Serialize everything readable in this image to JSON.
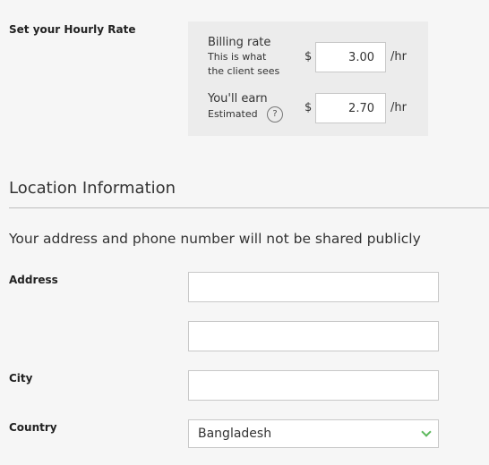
{
  "rate_section": {
    "title": "Set your Hourly Rate",
    "billing": {
      "label": "Billing rate",
      "sub1": "This is what",
      "sub2": "the client sees",
      "currency": "$",
      "value": "3.00",
      "unit": "/hr"
    },
    "earn": {
      "label": "You'll earn",
      "sub": "Estimated",
      "help": "?",
      "currency": "$",
      "value": "2.70",
      "unit": "/hr"
    }
  },
  "location": {
    "title": "Location Information",
    "notice": "Your address and phone number will not be shared publicly",
    "address_label": "Address",
    "address_line1": "",
    "address_line2": "",
    "city_label": "City",
    "city_value": "",
    "country_label": "Country",
    "country_value": "Bangladesh"
  },
  "colors": {
    "accent_chevron": "#5cb85c",
    "background": "#f6f6f6",
    "rate_box_bg": "#ececec"
  },
  "icons": {
    "help": "help-circle-icon",
    "dropdown": "chevron-down-icon"
  }
}
